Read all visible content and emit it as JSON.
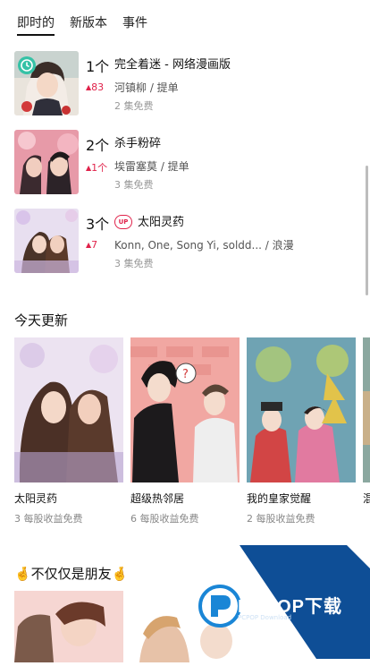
{
  "tabs": [
    {
      "label": "即时的",
      "active": true
    },
    {
      "label": "新版本",
      "active": false
    },
    {
      "label": "事件",
      "active": false
    }
  ],
  "ranking": [
    {
      "rank": "1个",
      "title": "完全着迷 - 网络漫画版",
      "badge": "",
      "delta": "83",
      "authors": "河镇柳 / 提单",
      "free": "2 集免费"
    },
    {
      "rank": "2个",
      "title": "杀手粉碎",
      "badge": "",
      "delta": "1个",
      "authors": "埃雷塞莫 / 提单",
      "free": "3 集免费"
    },
    {
      "rank": "3个",
      "title": "太阳灵药",
      "badge": "UP",
      "delta": "7",
      "authors": "Konn, One, Song Yi, soldd...  / 浪漫",
      "free": "3 集免费"
    }
  ],
  "today": {
    "title": "今天更新",
    "cards": [
      {
        "title": "太阳灵药",
        "sub": "3 每股收益免费"
      },
      {
        "title": "超级热邻居",
        "sub": "6 每股收益免费"
      },
      {
        "title": "我的皇家觉醒",
        "sub": "2 每股收益免费"
      },
      {
        "title": "混",
        "sub": ""
      }
    ]
  },
  "friends": {
    "title": "🤞不仅仅是朋友🤞"
  },
  "watermark": {
    "brand": "PCPOP下载",
    "sub": "PCPOP Download"
  },
  "colors": {
    "accent_red": "#e0224a",
    "watermark_blue": "#0e4e96"
  }
}
